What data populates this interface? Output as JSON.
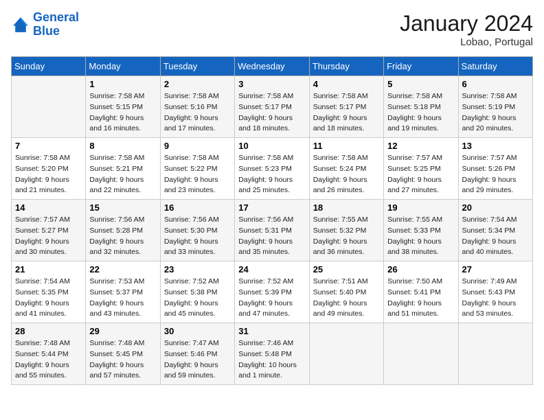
{
  "header": {
    "logo_line1": "General",
    "logo_line2": "Blue",
    "month": "January 2024",
    "location": "Lobao, Portugal"
  },
  "days_of_week": [
    "Sunday",
    "Monday",
    "Tuesday",
    "Wednesday",
    "Thursday",
    "Friday",
    "Saturday"
  ],
  "weeks": [
    [
      {
        "day": "",
        "sunrise": "",
        "sunset": "",
        "daylight": ""
      },
      {
        "day": "1",
        "sunrise": "Sunrise: 7:58 AM",
        "sunset": "Sunset: 5:15 PM",
        "daylight": "Daylight: 9 hours and 16 minutes."
      },
      {
        "day": "2",
        "sunrise": "Sunrise: 7:58 AM",
        "sunset": "Sunset: 5:16 PM",
        "daylight": "Daylight: 9 hours and 17 minutes."
      },
      {
        "day": "3",
        "sunrise": "Sunrise: 7:58 AM",
        "sunset": "Sunset: 5:17 PM",
        "daylight": "Daylight: 9 hours and 18 minutes."
      },
      {
        "day": "4",
        "sunrise": "Sunrise: 7:58 AM",
        "sunset": "Sunset: 5:17 PM",
        "daylight": "Daylight: 9 hours and 18 minutes."
      },
      {
        "day": "5",
        "sunrise": "Sunrise: 7:58 AM",
        "sunset": "Sunset: 5:18 PM",
        "daylight": "Daylight: 9 hours and 19 minutes."
      },
      {
        "day": "6",
        "sunrise": "Sunrise: 7:58 AM",
        "sunset": "Sunset: 5:19 PM",
        "daylight": "Daylight: 9 hours and 20 minutes."
      }
    ],
    [
      {
        "day": "7",
        "sunrise": "Sunrise: 7:58 AM",
        "sunset": "Sunset: 5:20 PM",
        "daylight": "Daylight: 9 hours and 21 minutes."
      },
      {
        "day": "8",
        "sunrise": "Sunrise: 7:58 AM",
        "sunset": "Sunset: 5:21 PM",
        "daylight": "Daylight: 9 hours and 22 minutes."
      },
      {
        "day": "9",
        "sunrise": "Sunrise: 7:58 AM",
        "sunset": "Sunset: 5:22 PM",
        "daylight": "Daylight: 9 hours and 23 minutes."
      },
      {
        "day": "10",
        "sunrise": "Sunrise: 7:58 AM",
        "sunset": "Sunset: 5:23 PM",
        "daylight": "Daylight: 9 hours and 25 minutes."
      },
      {
        "day": "11",
        "sunrise": "Sunrise: 7:58 AM",
        "sunset": "Sunset: 5:24 PM",
        "daylight": "Daylight: 9 hours and 26 minutes."
      },
      {
        "day": "12",
        "sunrise": "Sunrise: 7:57 AM",
        "sunset": "Sunset: 5:25 PM",
        "daylight": "Daylight: 9 hours and 27 minutes."
      },
      {
        "day": "13",
        "sunrise": "Sunrise: 7:57 AM",
        "sunset": "Sunset: 5:26 PM",
        "daylight": "Daylight: 9 hours and 29 minutes."
      }
    ],
    [
      {
        "day": "14",
        "sunrise": "Sunrise: 7:57 AM",
        "sunset": "Sunset: 5:27 PM",
        "daylight": "Daylight: 9 hours and 30 minutes."
      },
      {
        "day": "15",
        "sunrise": "Sunrise: 7:56 AM",
        "sunset": "Sunset: 5:28 PM",
        "daylight": "Daylight: 9 hours and 32 minutes."
      },
      {
        "day": "16",
        "sunrise": "Sunrise: 7:56 AM",
        "sunset": "Sunset: 5:30 PM",
        "daylight": "Daylight: 9 hours and 33 minutes."
      },
      {
        "day": "17",
        "sunrise": "Sunrise: 7:56 AM",
        "sunset": "Sunset: 5:31 PM",
        "daylight": "Daylight: 9 hours and 35 minutes."
      },
      {
        "day": "18",
        "sunrise": "Sunrise: 7:55 AM",
        "sunset": "Sunset: 5:32 PM",
        "daylight": "Daylight: 9 hours and 36 minutes."
      },
      {
        "day": "19",
        "sunrise": "Sunrise: 7:55 AM",
        "sunset": "Sunset: 5:33 PM",
        "daylight": "Daylight: 9 hours and 38 minutes."
      },
      {
        "day": "20",
        "sunrise": "Sunrise: 7:54 AM",
        "sunset": "Sunset: 5:34 PM",
        "daylight": "Daylight: 9 hours and 40 minutes."
      }
    ],
    [
      {
        "day": "21",
        "sunrise": "Sunrise: 7:54 AM",
        "sunset": "Sunset: 5:35 PM",
        "daylight": "Daylight: 9 hours and 41 minutes."
      },
      {
        "day": "22",
        "sunrise": "Sunrise: 7:53 AM",
        "sunset": "Sunset: 5:37 PM",
        "daylight": "Daylight: 9 hours and 43 minutes."
      },
      {
        "day": "23",
        "sunrise": "Sunrise: 7:52 AM",
        "sunset": "Sunset: 5:38 PM",
        "daylight": "Daylight: 9 hours and 45 minutes."
      },
      {
        "day": "24",
        "sunrise": "Sunrise: 7:52 AM",
        "sunset": "Sunset: 5:39 PM",
        "daylight": "Daylight: 9 hours and 47 minutes."
      },
      {
        "day": "25",
        "sunrise": "Sunrise: 7:51 AM",
        "sunset": "Sunset: 5:40 PM",
        "daylight": "Daylight: 9 hours and 49 minutes."
      },
      {
        "day": "26",
        "sunrise": "Sunrise: 7:50 AM",
        "sunset": "Sunset: 5:41 PM",
        "daylight": "Daylight: 9 hours and 51 minutes."
      },
      {
        "day": "27",
        "sunrise": "Sunrise: 7:49 AM",
        "sunset": "Sunset: 5:43 PM",
        "daylight": "Daylight: 9 hours and 53 minutes."
      }
    ],
    [
      {
        "day": "28",
        "sunrise": "Sunrise: 7:48 AM",
        "sunset": "Sunset: 5:44 PM",
        "daylight": "Daylight: 9 hours and 55 minutes."
      },
      {
        "day": "29",
        "sunrise": "Sunrise: 7:48 AM",
        "sunset": "Sunset: 5:45 PM",
        "daylight": "Daylight: 9 hours and 57 minutes."
      },
      {
        "day": "30",
        "sunrise": "Sunrise: 7:47 AM",
        "sunset": "Sunset: 5:46 PM",
        "daylight": "Daylight: 9 hours and 59 minutes."
      },
      {
        "day": "31",
        "sunrise": "Sunrise: 7:46 AM",
        "sunset": "Sunset: 5:48 PM",
        "daylight": "Daylight: 10 hours and 1 minute."
      },
      {
        "day": "",
        "sunrise": "",
        "sunset": "",
        "daylight": ""
      },
      {
        "day": "",
        "sunrise": "",
        "sunset": "",
        "daylight": ""
      },
      {
        "day": "",
        "sunrise": "",
        "sunset": "",
        "daylight": ""
      }
    ]
  ]
}
